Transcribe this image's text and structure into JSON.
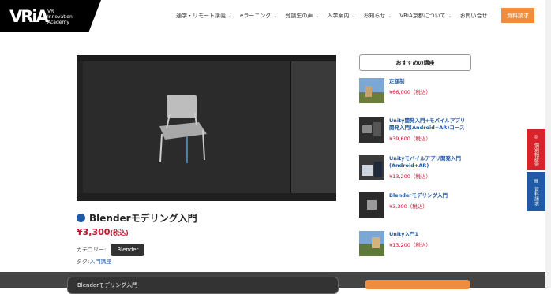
{
  "header": {
    "logo_mark": "VRiA",
    "logo_text": [
      "VR",
      "Innovation",
      "Academy"
    ],
    "nav": [
      {
        "label": "通学・リモート講義",
        "dropdown": true
      },
      {
        "label": "eラーニング",
        "dropdown": true
      },
      {
        "label": "受講生の声",
        "dropdown": true
      },
      {
        "label": "入学案内",
        "dropdown": true
      },
      {
        "label": "お知らせ",
        "dropdown": true
      },
      {
        "label": "VRiA京都について",
        "dropdown": true
      },
      {
        "label": "お問い合せ",
        "dropdown": false
      }
    ],
    "cta": "資料請求"
  },
  "course": {
    "title": "Blenderモデリング入門",
    "price": "¥3,300",
    "tax": "(税込)",
    "category_label": "カテゴリー:",
    "category": "Blender",
    "tag_label": "タグ:",
    "tag": "入門講座"
  },
  "recommend": {
    "heading": "おすすめの講座",
    "items": [
      {
        "title": "定額制",
        "price": "¥66,000（税込）"
      },
      {
        "title": "Unity開発入門+モバイルアプリ開発入門(Android+AR)コース",
        "price": "¥39,600（税込）"
      },
      {
        "title": "Unityモバイルアプリ開発入門(Android+AR)",
        "price": "¥13,200（税込）"
      },
      {
        "title": "Blenderモデリング入門",
        "price": "¥3,300（税込）"
      },
      {
        "title": "Unity入門1",
        "price": "¥13,200（税込）"
      }
    ]
  },
  "side_tabs": [
    {
      "label": "個別相談会",
      "color": "#d8232a"
    },
    {
      "label": "資料請求",
      "color": "#1f5aa6"
    }
  ],
  "footer": {
    "card_title": "Blenderモデリング入門"
  },
  "colors": {
    "accent": "#f08c3c",
    "brand_blue": "#1f5aa6",
    "price_red": "#c8102e"
  }
}
